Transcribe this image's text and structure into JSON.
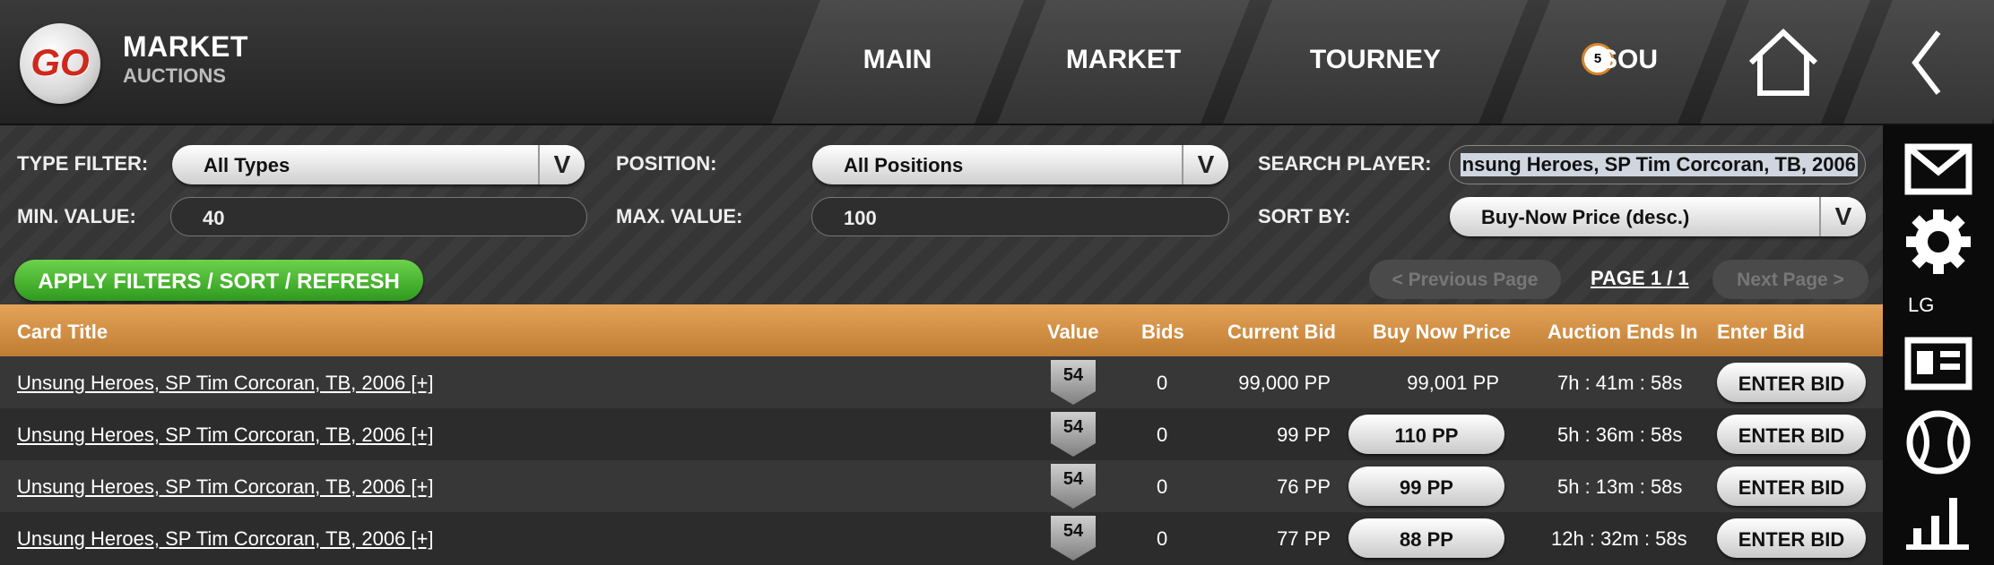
{
  "header": {
    "logo_text": "GO",
    "title": "MARKET",
    "subtitle": "AUCTIONS",
    "nav": [
      {
        "label": "MAIN"
      },
      {
        "label": "MARKET"
      },
      {
        "label": "TOURNEY"
      },
      {
        "label": "SOU",
        "coin": "5"
      }
    ],
    "home_icon": "home-icon",
    "back_icon": "back-chevron-icon"
  },
  "sidebar": {
    "icons": [
      "mail-icon",
      "gear-icon",
      "news-icon",
      "baseball-icon",
      "stats-icon"
    ],
    "lg_label": "LG"
  },
  "filters": {
    "type_label": "TYPE FILTER:",
    "type_value": "All Types",
    "position_label": "POSITION:",
    "position_value": "All Positions",
    "search_label": "SEARCH PLAYER:",
    "search_value": "nsung Heroes, SP Tim Corcoran, TB, 2006",
    "min_label": "MIN. VALUE:",
    "min_value": "40",
    "max_label": "MAX. VALUE:",
    "max_value": "100",
    "sort_label": "SORT BY:",
    "sort_value": "Buy-Now Price (desc.)",
    "dropdown_arrow": "V",
    "apply_label": "APPLY FILTERS / SORT / REFRESH",
    "prev_label": "< Previous Page",
    "page_indicator": "PAGE 1 / 1",
    "next_label": "Next Page >"
  },
  "table": {
    "columns": {
      "title": "Card Title",
      "value": "Value",
      "bids": "Bids",
      "current_bid": "Current Bid",
      "buy_now": "Buy Now Price",
      "ends": "Auction Ends In",
      "enter": "Enter Bid"
    },
    "rows": [
      {
        "title": "Unsung Heroes, SP Tim Corcoran, TB, 2006   [+]",
        "value": "54",
        "bids": "0",
        "current_bid": "99,000 PP",
        "buy_now": "99,001 PP",
        "ends": "7h : 41m : 58s",
        "enter": "ENTER BID"
      },
      {
        "title": "Unsung Heroes, SP Tim Corcoran, TB, 2006   [+]",
        "value": "54",
        "bids": "0",
        "current_bid": "99 PP",
        "buy_now": "110 PP",
        "ends": "5h : 36m : 58s",
        "enter": "ENTER BID"
      },
      {
        "title": "Unsung Heroes, SP Tim Corcoran, TB, 2006   [+]",
        "value": "54",
        "bids": "0",
        "current_bid": "76 PP",
        "buy_now": "99 PP",
        "ends": "5h : 13m : 58s",
        "enter": "ENTER BID"
      },
      {
        "title": "Unsung Heroes, SP Tim Corcoran, TB, 2006   [+]",
        "value": "54",
        "bids": "0",
        "current_bid": "77 PP",
        "buy_now": "88 PP",
        "ends": "12h : 32m : 58s",
        "enter": "ENTER BID"
      }
    ]
  }
}
